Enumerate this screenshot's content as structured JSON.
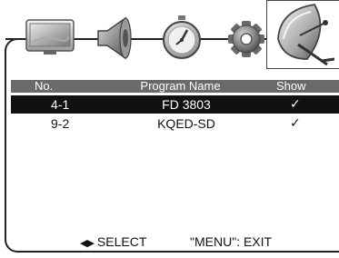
{
  "menu_icons": [
    {
      "name": "picture-icon"
    },
    {
      "name": "sound-icon"
    },
    {
      "name": "timer-icon"
    },
    {
      "name": "setup-icon"
    },
    {
      "name": "channel-icon",
      "selected": true
    }
  ],
  "table": {
    "headers": {
      "no": "No.",
      "program_name": "Program Name",
      "show": "Show"
    },
    "rows": [
      {
        "no": "4-1",
        "name": "FD 3803",
        "show": "✓",
        "selected": true
      },
      {
        "no": "9-2",
        "name": "KQED-SD",
        "show": "✓",
        "selected": false
      }
    ]
  },
  "footer": {
    "select_icon": "◀▶",
    "select_label": "SELECT",
    "exit_label": "\"MENU\": EXIT"
  },
  "colors": {
    "header_bg": "#6a6a6a",
    "selected_row_bg": "#111111",
    "frame": "#222222"
  }
}
